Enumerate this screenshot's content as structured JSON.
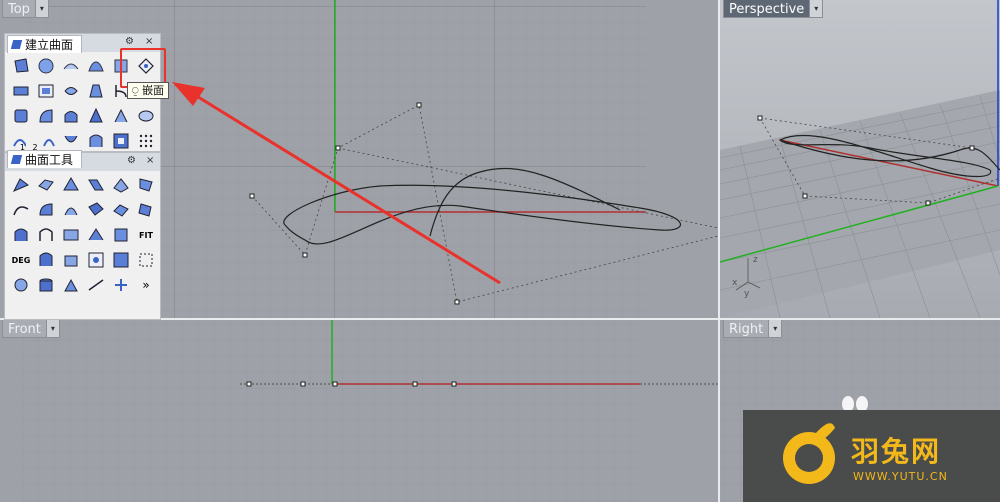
{
  "viewports": {
    "top": {
      "label": "Top"
    },
    "perspective": {
      "label": "Perspective"
    },
    "front": {
      "label": "Front"
    },
    "right": {
      "label": "Right"
    }
  },
  "panels": {
    "create_surface": {
      "title": "建立曲面",
      "gear": "⚙",
      "close": "×"
    },
    "surface_tools": {
      "title": "曲面工具",
      "gear": "⚙",
      "close": "×",
      "more": "»"
    }
  },
  "tooltip": {
    "text": "嵌面"
  },
  "small_labels": {
    "one": "1",
    "two": "2",
    "deg": "DEG",
    "fit": "FIT"
  },
  "axis_labels": {
    "z": "z",
    "y": "y",
    "x": "x"
  },
  "watermark": {
    "brand": "羽兔网",
    "url": "WWW.YUTU.CN"
  },
  "colors": {
    "highlight": "#e8322b",
    "x_axis": "#b03030",
    "y_axis": "#20b020",
    "logo": "#f3b81a"
  }
}
